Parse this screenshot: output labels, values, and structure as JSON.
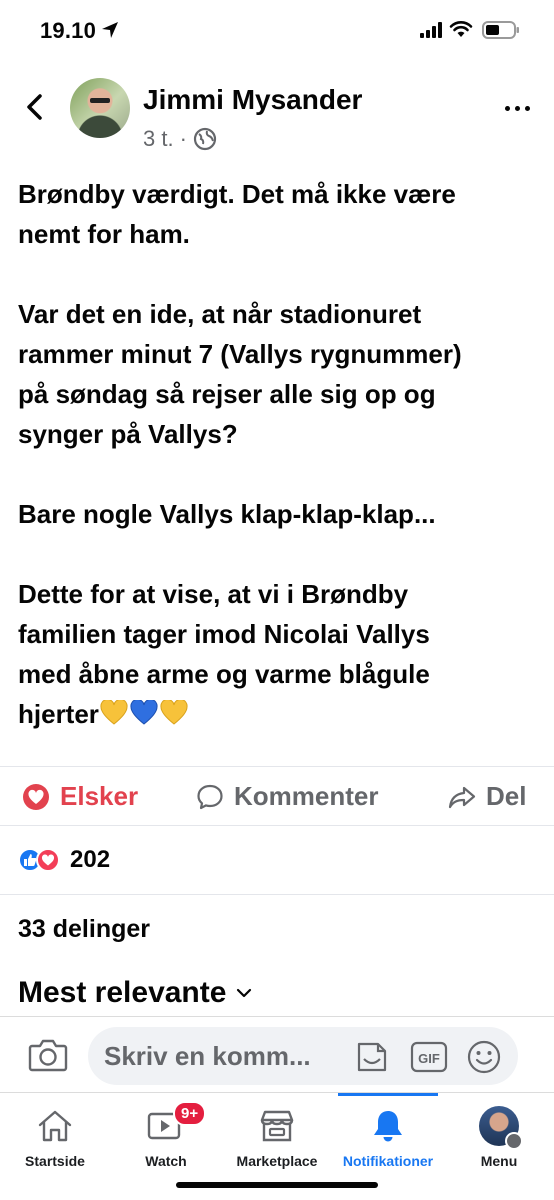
{
  "status_bar": {
    "time": "19.10"
  },
  "post": {
    "author": "Jimmi Mysander",
    "time_ago": "3 t.",
    "separator": "·",
    "body": "Brøndby værdigt. Det må ikke være\nnemt for ham.\n\nVar det en ide, at når stadionuret\nrammer minut 7 (Vallys rygnummer)\npå søndag så rejser alle sig op og\nsynger på Vallys?\n\nBare nogle Vallys klap-klap-klap...\n\nDette for at vise, at vi i Brøndby\nfamilien tager imod Nicolai Vallys\nmed åbne arme og varme blågule\nhjerter",
    "emojis": [
      "yellow-heart",
      "blue-heart",
      "yellow-heart"
    ]
  },
  "actions": {
    "love_label": "Elsker",
    "comment_label": "Kommenter",
    "share_label": "Del"
  },
  "stats": {
    "reaction_count": "202",
    "shares": "33 delinger",
    "sort_label": "Mest relevante"
  },
  "comment_bar": {
    "placeholder": "Skriv en komm..."
  },
  "tabs": [
    {
      "label": "Startside",
      "icon": "home-icon"
    },
    {
      "label": "Watch",
      "icon": "watch-icon",
      "badge": "9+"
    },
    {
      "label": "Marketplace",
      "icon": "marketplace-icon"
    },
    {
      "label": "Notifikationer",
      "icon": "bell-icon",
      "active": true
    },
    {
      "label": "Menu",
      "icon": "menu-avatar"
    }
  ],
  "colors": {
    "accent": "#1877f2",
    "love": "#e2424e",
    "secondary_text": "#65676b",
    "badge": "#e41e3f"
  }
}
